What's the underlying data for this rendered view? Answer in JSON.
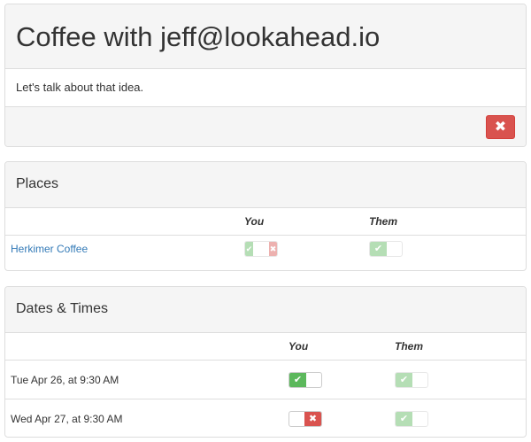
{
  "meeting": {
    "title": "Coffee with jeff@lookahead.io",
    "description": "Let's talk about that idea.",
    "delete_icon": "✖"
  },
  "places": {
    "heading": "Places",
    "col_you": "You",
    "col_them": "Them",
    "rows": [
      {
        "name": "Herkimer Coffee",
        "you": "mixed",
        "them": "yes"
      }
    ]
  },
  "dates": {
    "heading": "Dates & Times",
    "col_you": "You",
    "col_them": "Them",
    "rows": [
      {
        "label": "Tue Apr 26, at 9:30 AM",
        "you": "yes",
        "them": "yes"
      },
      {
        "label": "Wed Apr 27, at 9:30 AM",
        "you": "no",
        "them": "yes"
      }
    ]
  },
  "icons": {
    "check": "✔",
    "cross": "✖"
  },
  "colors": {
    "accept": "#5cb85c",
    "reject": "#d9534f",
    "link": "#337ab7"
  }
}
